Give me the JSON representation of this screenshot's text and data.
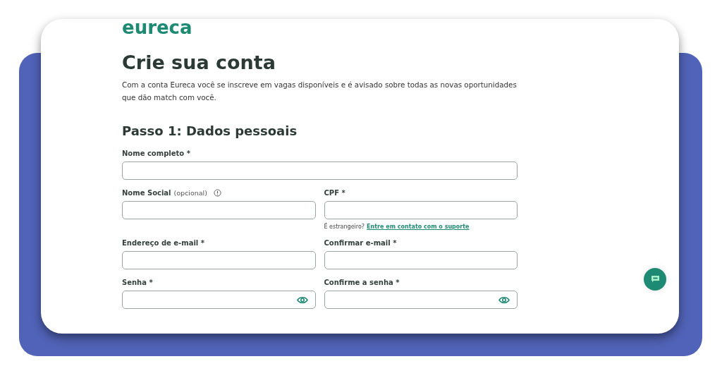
{
  "logo": "eureca",
  "title": "Crie sua conta",
  "description": "Com a conta Eureca você se inscreve em vagas disponíveis e é avisado sobre todas as novas oportunidades que dão match com você.",
  "section_title": "Passo 1: Dados pessoais",
  "rows": [
    [
      {
        "label": "Nome completo *",
        "kind": "text"
      }
    ],
    [
      {
        "label": "Nome Social",
        "note": "(opcional)",
        "info": true,
        "kind": "text"
      },
      {
        "label": "CPF *",
        "kind": "text",
        "hint": "É estrangeiro?",
        "hint_link": "Entre em contato com o suporte"
      }
    ],
    [
      {
        "label": "Endereço de e-mail *",
        "kind": "text"
      },
      {
        "label": "Confirmar e-mail *",
        "kind": "text"
      }
    ],
    [
      {
        "label": "Senha *",
        "kind": "password"
      },
      {
        "label": "Confirme a senha *",
        "kind": "password"
      }
    ]
  ]
}
